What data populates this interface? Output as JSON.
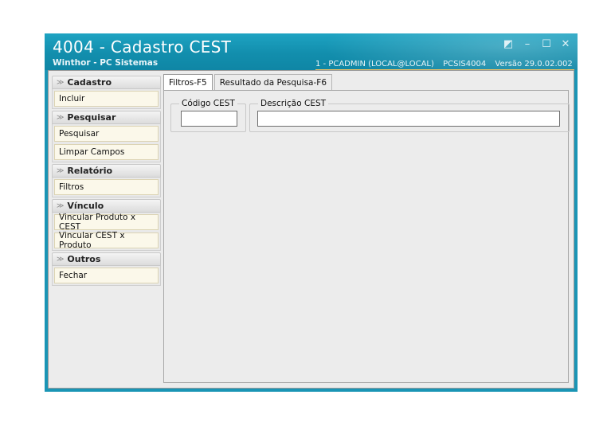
{
  "window": {
    "title": "4004 - Cadastro CEST",
    "subtitle": "Winthor - PC Sistemas",
    "status": {
      "user": "1 - PCADMIN (LOCAL@LOCAL)",
      "program": "PCSIS4004",
      "version": "Versão  29.0.02.002"
    },
    "buttons": {
      "restore": "◩",
      "minimize": "–",
      "maximize": "☐",
      "close": "✕"
    }
  },
  "sidebar": {
    "groups": [
      {
        "label": "Cadastro",
        "items": [
          "Incluir"
        ]
      },
      {
        "label": "Pesquisar",
        "items": [
          "Pesquisar",
          "Limpar Campos"
        ]
      },
      {
        "label": "Relatório",
        "items": [
          "Filtros"
        ]
      },
      {
        "label": "Vínculo",
        "items": [
          "Vincular Produto x CEST",
          "Vincular CEST x Produto"
        ]
      },
      {
        "label": "Outros",
        "items": [
          "Fechar"
        ]
      }
    ],
    "chevron_icon": "double-chevron-down-icon",
    "chevron_glyph": "≫"
  },
  "tabs": [
    {
      "label": "Filtros-F5",
      "active": true
    },
    {
      "label": "Resultado da Pesquisa-F6",
      "active": false
    }
  ],
  "filters": {
    "codigo": {
      "label": "Código CEST",
      "value": ""
    },
    "descricao": {
      "label": "Descrição CEST",
      "value": ""
    }
  }
}
